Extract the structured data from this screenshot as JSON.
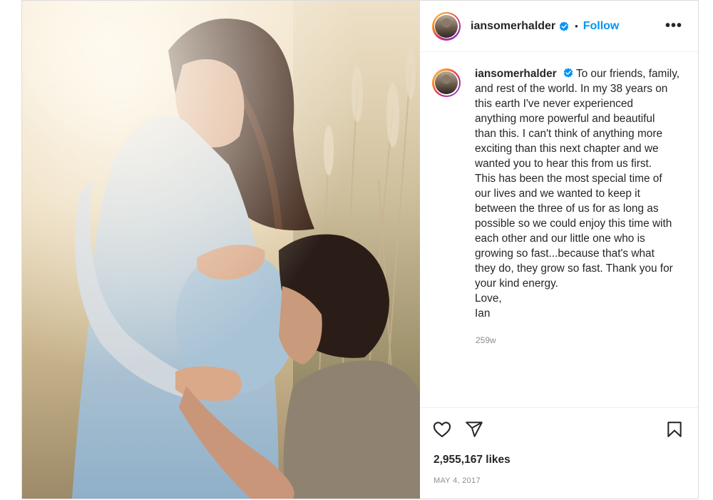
{
  "post": {
    "photo_alt": "",
    "account": {
      "username": "iansomerhalder",
      "verified": true,
      "follow_label": "Follow",
      "dot": "•",
      "more_label": "•••"
    },
    "caption": {
      "username": "iansomerhalder",
      "text": "To our friends, family,\nand rest of the world. In my 38 years on\nthis earth I've never experienced\nanything more powerful and beautiful\nthan this. I can't think of anything more\nexciting than this next chapter and we\nwanted you to hear this from us first.\nThis has been the most special time of\nour lives and we wanted to keep it\nbetween the three of us for as long as\npossible so we could enjoy this time with\neach other and our little one who is\ngrowing so fast...because that's what\nthey do, they grow so fast. Thank you for\nyour kind energy.\nLove,\nIan",
      "age": "259w"
    },
    "likes": "2,955,167 likes",
    "date": "MAY 4, 2017",
    "colors": {
      "follow": "#0095f6",
      "verified": "#0095f6",
      "muted": "#8e8e8e",
      "text": "#262626"
    },
    "icons": [
      "heart-icon",
      "share-icon",
      "bookmark-icon",
      "verified-badge-icon",
      "more-icon"
    ]
  }
}
